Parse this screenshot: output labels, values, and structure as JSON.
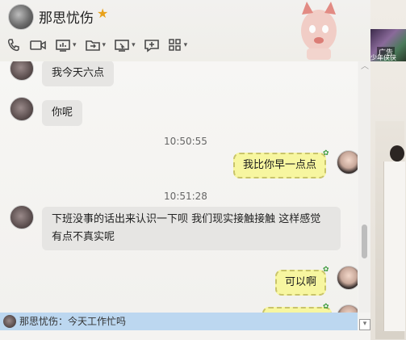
{
  "header": {
    "contact_name": "那思忧伤"
  },
  "toolbar": {
    "icons": [
      "phone-icon",
      "video-icon",
      "screen-share-icon",
      "file-transfer-icon",
      "remote-desktop-icon",
      "chat-add-icon",
      "apps-grid-icon"
    ]
  },
  "messages": [
    {
      "side": "left",
      "text": "我今天六点"
    },
    {
      "side": "left",
      "text": "你呢"
    },
    {
      "time": "10:50:55"
    },
    {
      "side": "right",
      "text": "我比你早一点点"
    },
    {
      "time": "10:51:28"
    },
    {
      "side": "left",
      "text": "下班没事的话出来认识一下呗  我们现实接触接触  这样感觉有点不真实呢"
    },
    {
      "side": "right",
      "text": "可以啊"
    }
  ],
  "ticker": {
    "text": "那思忧伤：今天工作忙吗"
  },
  "ad": {
    "label": "广告",
    "sub": "少年侠侠"
  },
  "colors": {
    "left_bubble": "#e6e5e3",
    "right_bubble": "#f7f6a0",
    "ticker_bg": "#bcd7f0"
  }
}
